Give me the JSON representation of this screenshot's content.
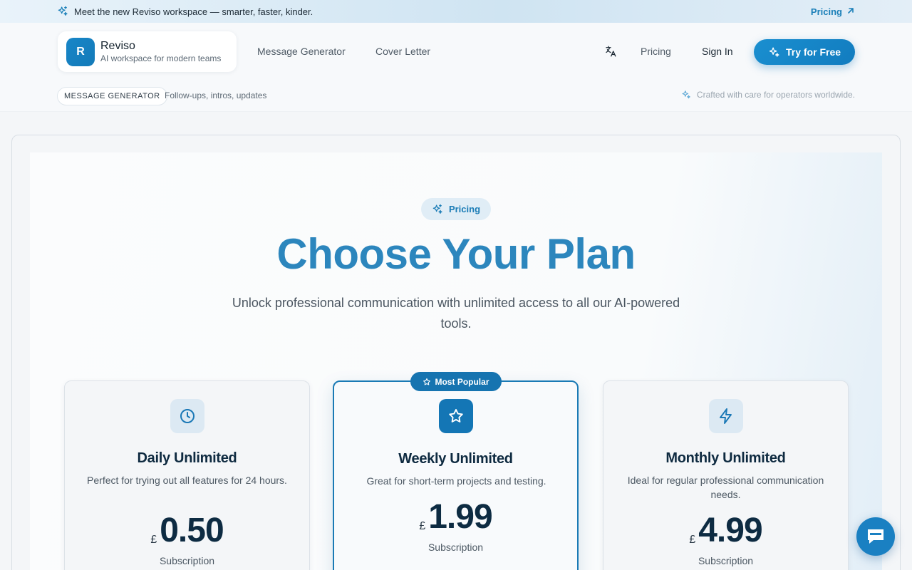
{
  "announcement": {
    "message": "Meet the new Reviso workspace — smarter, faster, kinder.",
    "link_label": "Pricing"
  },
  "header": {
    "brand_initial": "R",
    "brand_name": "Reviso",
    "brand_tagline": "AI workspace for modern teams",
    "nav": [
      "Message Generator",
      "Cover Letter"
    ],
    "pricing_label": "Pricing",
    "signin_label": "Sign In",
    "cta_label": "Try for Free"
  },
  "subheader": {
    "pill": "MESSAGE GENERATOR",
    "pill_desc": "Follow-ups, intros, updates",
    "crafted": "Crafted with care for operators worldwide."
  },
  "hero": {
    "badge": "Pricing",
    "title": "Choose Your Plan",
    "subtitle": "Unlock professional communication with unlimited access to all our AI-powered tools."
  },
  "plans": [
    {
      "icon": "clock-icon",
      "name": "Daily Unlimited",
      "desc": "Perfect for trying out all features for 24 hours.",
      "currency": "£",
      "price": "0.50",
      "billing": "Subscription"
    },
    {
      "icon": "star-icon",
      "name": "Weekly Unlimited",
      "desc": "Great for short-term projects and testing.",
      "currency": "£",
      "price": "1.99",
      "billing": "Subscription",
      "badge": "Most Popular"
    },
    {
      "icon": "lightning-icon",
      "name": "Monthly Unlimited",
      "desc": "Ideal for regular professional communication needs.",
      "currency": "£",
      "price": "4.99",
      "billing": "Subscription"
    }
  ],
  "colors": {
    "accent": "#1a80c2",
    "title": "#2c86bd",
    "dark_text": "#0d2b42"
  }
}
